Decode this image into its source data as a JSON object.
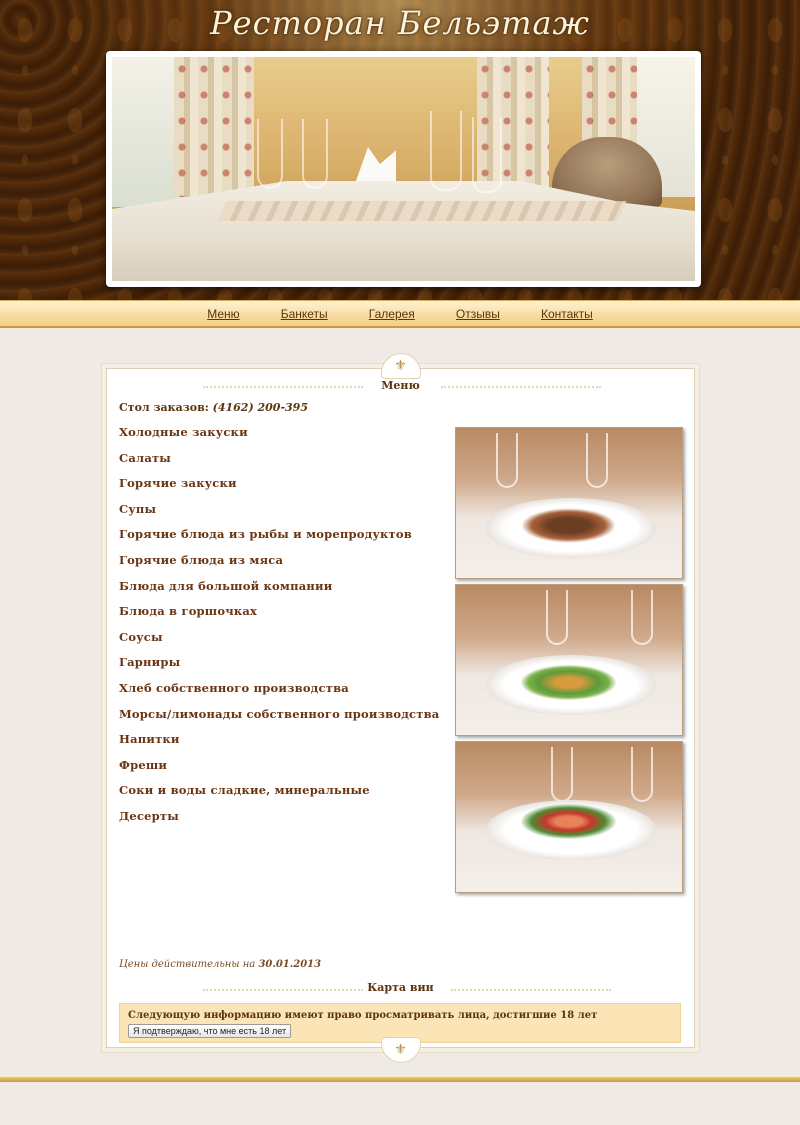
{
  "site": {
    "logo_text": "Ресторан Бельэтаж"
  },
  "nav": {
    "items": [
      {
        "label": "Меню"
      },
      {
        "label": "Банкеты"
      },
      {
        "label": "Галерея"
      },
      {
        "label": "Отзывы"
      },
      {
        "label": "Контакты"
      }
    ]
  },
  "content": {
    "section_title": "Меню",
    "phone_label": "Стол заказов:",
    "phone_number": "(4162) 200-395",
    "menu_items": [
      "Холодные закуски",
      "Салаты",
      "Горячие закуски",
      "Супы",
      "Горячие блюда из рыбы и морепродуктов",
      "Горячие блюда из мяса",
      "Блюда для большой компании",
      "Блюда в горшочках",
      "Соусы",
      "Гарниры",
      "Хлеб собственного производства",
      "Морсы/лимонады собственного производства",
      "Напитки",
      "Фреши",
      "Соки и воды сладкие, минеральные",
      "Десерты"
    ],
    "prices_valid_label": "Цены действительны на",
    "prices_valid_date": "30.01.2013",
    "wine_title": "Карта вин",
    "age_notice": "Следующую информацию имеют право просматривать лица, достигшие 18 лет",
    "age_button": "Я подтверждаю, что мне есть 18 лет"
  },
  "colors": {
    "accent_brown": "#5b3410",
    "nav_gold": "#f8dfa6",
    "age_box": "#fbe5b6"
  }
}
